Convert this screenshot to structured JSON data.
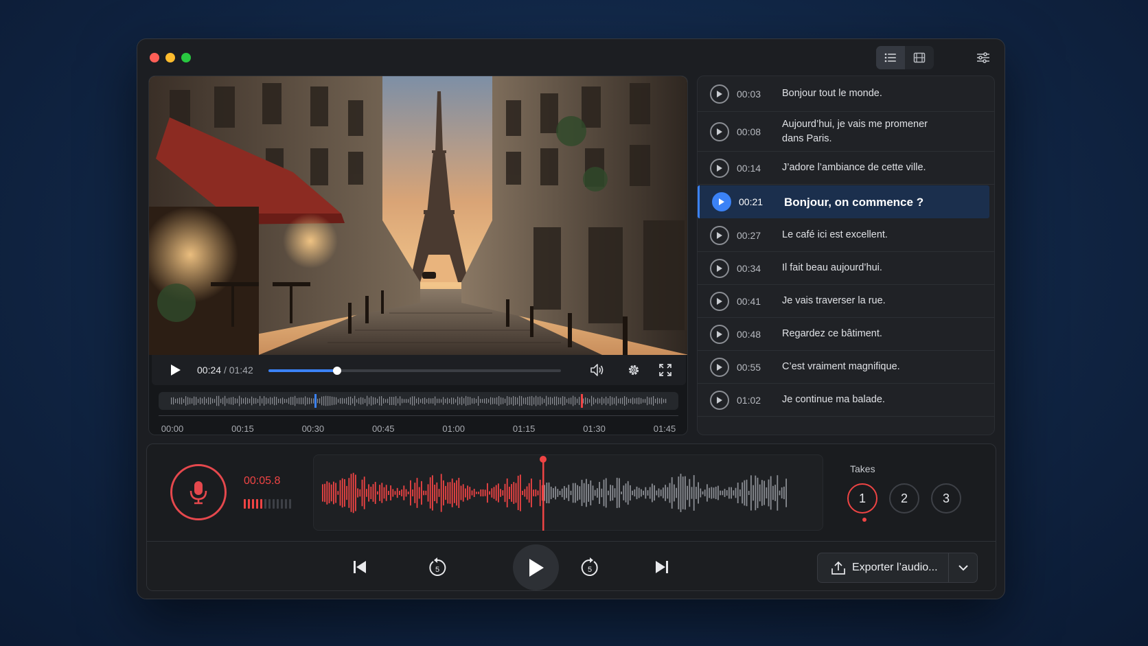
{
  "window": {
    "view_modes": [
      {
        "name": "list-view",
        "icon": "list-icon",
        "active": true
      },
      {
        "name": "filmstrip-view",
        "icon": "film-icon",
        "active": false
      }
    ],
    "settings_icon": "sliders-icon"
  },
  "video": {
    "current_time": "00:24",
    "separator": "/",
    "duration": "01:42",
    "progress": 0.235,
    "ruler": [
      "00:00",
      "00:15",
      "00:30",
      "00:45",
      "01:00",
      "01:15",
      "01:30",
      "01:45"
    ],
    "colors": {
      "accent": "#3b82f6",
      "marker": "#ef4444"
    }
  },
  "transcript": {
    "items": [
      {
        "time": "00:03",
        "text": "Bonjour tout le monde.",
        "active": false
      },
      {
        "time": "00:08",
        "text": "Aujourd’hui, je vais me promener dans Paris.",
        "active": false
      },
      {
        "time": "00:14",
        "text": "J’adore l’ambiance de cette ville.",
        "active": false
      },
      {
        "time": "00:21",
        "text": "Bonjour, on commence ?",
        "active": true
      },
      {
        "time": "00:27",
        "text": "Le café ici est excellent.",
        "active": false
      },
      {
        "time": "00:34",
        "text": "Il fait beau aujourd’hui.",
        "active": false
      },
      {
        "time": "00:41",
        "text": "Je vais traverser la rue.",
        "active": false
      },
      {
        "time": "00:48",
        "text": "Regardez ce bâtiment.",
        "active": false
      },
      {
        "time": "00:55",
        "text": "C’est vraiment magnifique.",
        "active": false
      },
      {
        "time": "01:02",
        "text": "Je continue ma balade.",
        "active": false
      }
    ]
  },
  "recorder": {
    "elapsed": "00:05.8",
    "level_segments_on": 5,
    "level_segments_total": 12,
    "record_color": "#ef4444",
    "takes_label": "Takes",
    "takes": [
      "1",
      "2",
      "3"
    ],
    "active_take": 0
  },
  "transport": {
    "skip_back_seconds": "5",
    "skip_forward_seconds": "5",
    "export_label": "Exporter l’audio..."
  }
}
